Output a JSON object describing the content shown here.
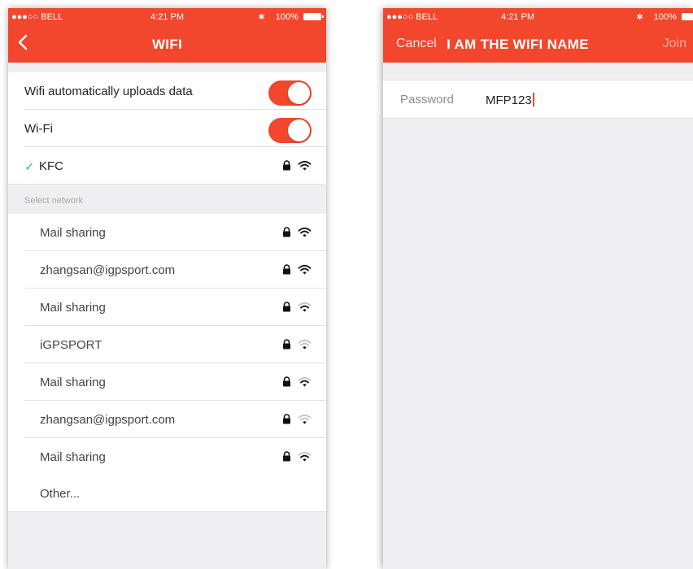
{
  "status_bar": {
    "carrier": "●●●○○ BELL",
    "time": "4:21 PM",
    "battery": "100%"
  },
  "left_screen": {
    "title": "WIFI",
    "auto_upload": {
      "label": "Wifi automatically uploads data",
      "on": true
    },
    "wifi": {
      "label": "Wi-Fi",
      "on": true
    },
    "connected": {
      "name": "KFC",
      "locked": true,
      "signal": 3
    },
    "section_label": "Select network",
    "networks": [
      {
        "name": "Mail sharing",
        "locked": true,
        "signal": 3
      },
      {
        "name": "zhangsan@igpsport.com",
        "locked": true,
        "signal": 3
      },
      {
        "name": "Mail sharing",
        "locked": true,
        "signal": 2
      },
      {
        "name": "iGPSPORT",
        "locked": true,
        "signal": 1
      },
      {
        "name": "Mail sharing",
        "locked": true,
        "signal": 2
      },
      {
        "name": "zhangsan@igpsport.com",
        "locked": true,
        "signal": 1
      },
      {
        "name": "Mail sharing",
        "locked": true,
        "signal": 2
      }
    ],
    "other_label": "Other..."
  },
  "right_screen": {
    "title": "I AM THE WIFI NAME",
    "cancel_label": "Cancel",
    "join_label": "Join",
    "password_label": "Password",
    "password_value": "MFP123"
  },
  "colors": {
    "accent": "#f2462d",
    "background": "#efeff1",
    "check": "#3cc25a"
  }
}
